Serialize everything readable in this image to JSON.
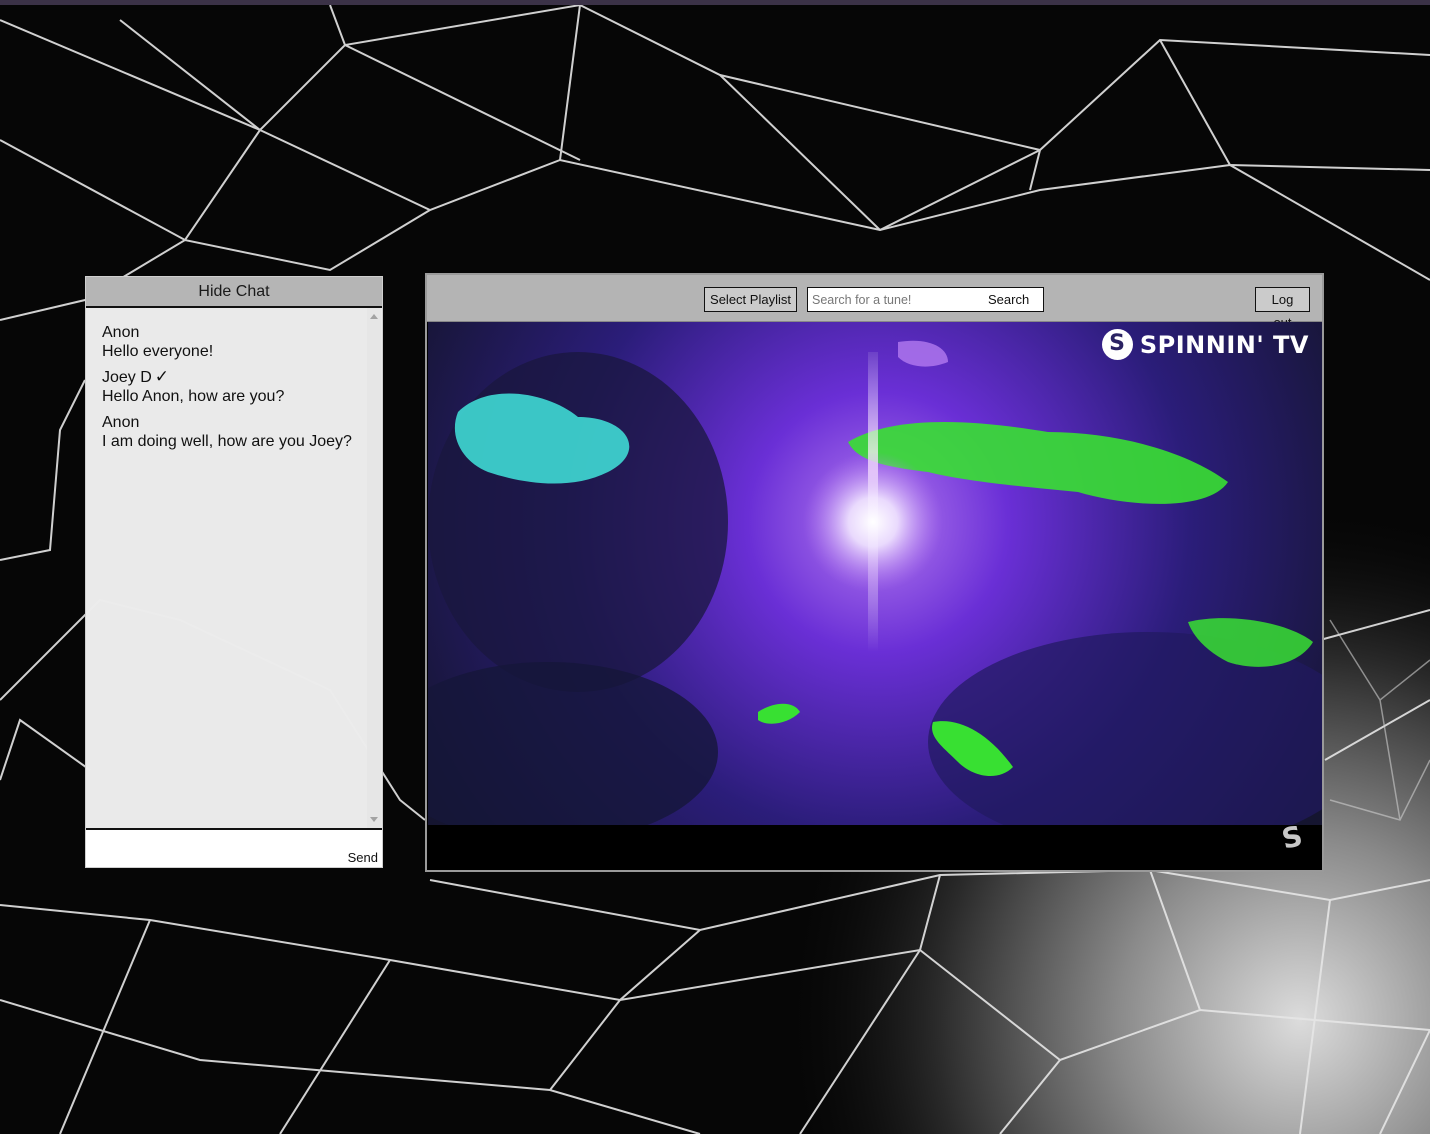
{
  "chat": {
    "toggle_label": "Hide Chat",
    "messages": [
      {
        "author": "Anon",
        "text": "Hello everyone!",
        "verified": false
      },
      {
        "author": "Joey D",
        "text": "Hello Anon, how are you?",
        "verified": true
      },
      {
        "author": "Anon",
        "text": "I am doing well, how are you Joey?",
        "verified": false
      }
    ],
    "input_value": "",
    "send_label": "Send",
    "verified_icon": "checkmark-icon"
  },
  "toolbar": {
    "playlist_label": "Select Playlist",
    "search_placeholder": "Search for a tune!",
    "search_value": "",
    "search_label": "Search",
    "logout_label": "Log out"
  },
  "video": {
    "brand_text": "SPINNIN' TV",
    "brand_logo_letter": "S",
    "corner_logo_letter": "S"
  },
  "colors": {
    "background": "#060606",
    "panel_header": "#b5b5b5",
    "chat_bg": "#ececec",
    "video_purple": "#6a2fd6",
    "video_green": "#38e032",
    "video_cyan": "#3fd9d4"
  }
}
